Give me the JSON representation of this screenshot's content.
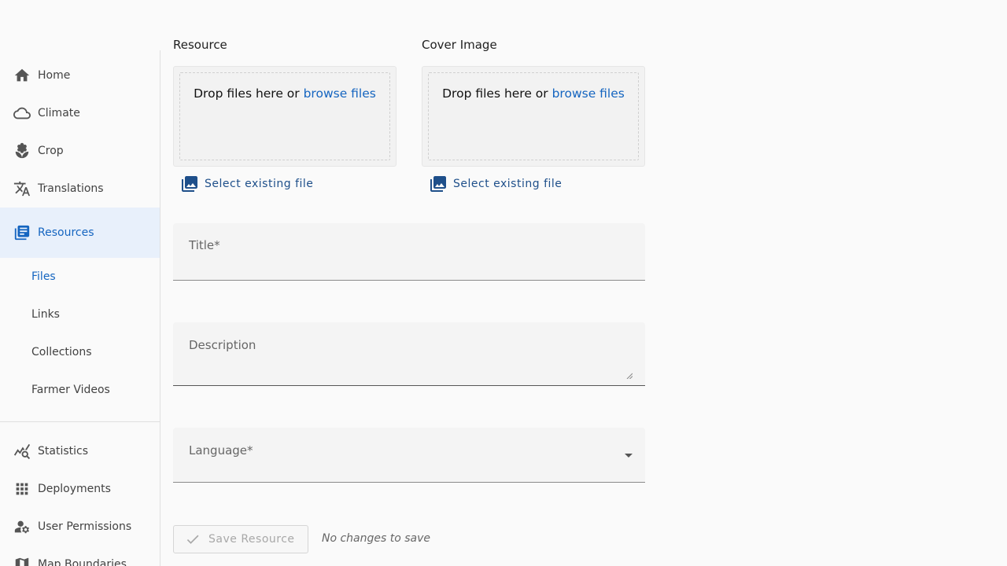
{
  "sidebar": {
    "items": [
      {
        "label": "Home",
        "icon": "home-icon"
      },
      {
        "label": "Climate",
        "icon": "cloud-icon"
      },
      {
        "label": "Crop",
        "icon": "sprout-icon"
      },
      {
        "label": "Translations",
        "icon": "translate-icon"
      },
      {
        "label": "Resources",
        "icon": "library-icon",
        "active": true
      }
    ],
    "sub_items": [
      {
        "label": "Files",
        "active": true
      },
      {
        "label": "Links"
      },
      {
        "label": "Collections"
      },
      {
        "label": "Farmer Videos"
      }
    ],
    "bottom_items": [
      {
        "label": "Statistics",
        "icon": "query-stats-icon"
      },
      {
        "label": "Deployments",
        "icon": "apps-grid-icon"
      },
      {
        "label": "User Permissions",
        "icon": "manage-accounts-icon"
      },
      {
        "label": "Map Boundaries",
        "icon": "map-icon"
      }
    ],
    "accent_color": "#1565c0"
  },
  "form": {
    "resource_label": "Resource",
    "cover_label": "Cover Image",
    "drop_text": "Drop files here or ",
    "browse_text": "browse files",
    "select_existing": "Select existing file",
    "title_label": "Title*",
    "description_label": "Description",
    "language_label": "Language*",
    "save_label": "Save Resource",
    "status": "No changes to save"
  }
}
